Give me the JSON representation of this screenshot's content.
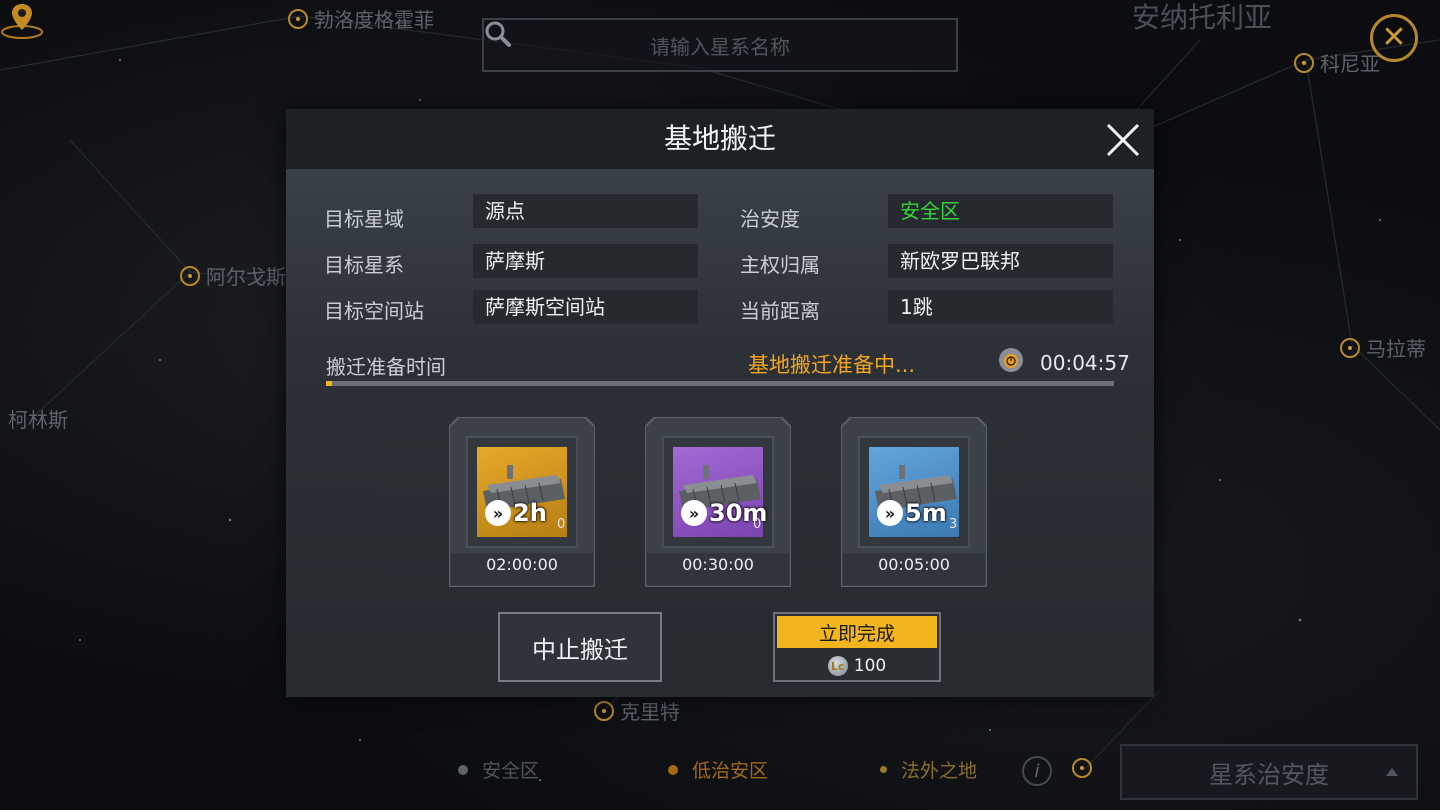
{
  "map": {
    "search_placeholder": "请输入星系名称",
    "region_label": "安纳托利亚",
    "nodes": [
      {
        "name": "勃洛度格霍菲"
      },
      {
        "name": "科尼亚"
      },
      {
        "name": "阿尔戈斯"
      },
      {
        "name": "马拉蒂"
      },
      {
        "name": "柯林斯"
      },
      {
        "name": "克里特"
      }
    ],
    "legend": {
      "safe": "安全区",
      "low_sec": "低治安区",
      "lawless": "法外之地"
    },
    "security_button": "星系治安度",
    "colors": {
      "safe": "#8a8f95",
      "low_sec": "#c9851c",
      "lawless": "#b08a2a"
    }
  },
  "dialog": {
    "title": "基地搬迁",
    "fields": {
      "target_domain_label": "目标星域",
      "target_domain_value": "源点",
      "security_label": "治安度",
      "security_value": "安全区",
      "target_system_label": "目标星系",
      "target_system_value": "萨摩斯",
      "sovereignty_label": "主权归属",
      "sovereignty_value": "新欧罗巴联邦",
      "target_station_label": "目标空间站",
      "target_station_value": "萨摩斯空间站",
      "distance_label": "当前距离",
      "distance_value": "1跳"
    },
    "progress": {
      "label": "搬迁准备时间",
      "status": "基地搬迁准备中...",
      "remaining": "00:04:57",
      "fraction": 0.008
    },
    "speedups": [
      {
        "amount": "2h",
        "count": "0",
        "duration": "02:00:00",
        "rarity": "gold"
      },
      {
        "amount": "30m",
        "count": "0",
        "duration": "00:30:00",
        "rarity": "purple"
      },
      {
        "amount": "5m",
        "count": "3",
        "duration": "00:05:00",
        "rarity": "blue"
      }
    ],
    "abort_button": "中止搬迁",
    "finish_button": "立即完成",
    "finish_cost": "100",
    "colors": {
      "accent": "#f3b51d",
      "safe_text": "#35d33a",
      "status_text": "#f3a51e"
    }
  }
}
